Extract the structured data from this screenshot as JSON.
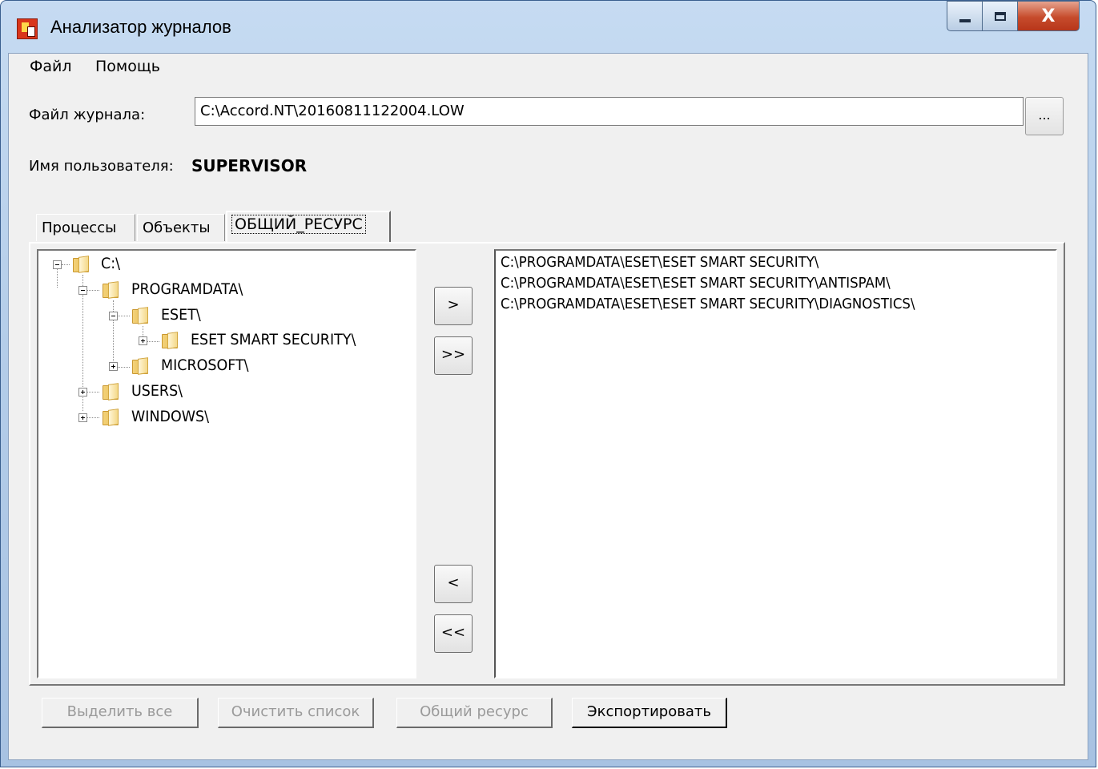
{
  "window": {
    "title": "Анализатор журналов",
    "close_glyph": "X"
  },
  "menu": {
    "items": [
      "Файл",
      "Помощь"
    ]
  },
  "logfile": {
    "label": "Файл журнала:",
    "value": "C:\\Accord.NT\\20160811122004.LOW",
    "browse_label": "..."
  },
  "user": {
    "label": "Имя пользователя:",
    "value": "SUPERVISOR"
  },
  "tabs": [
    {
      "label": "Процессы",
      "active": false
    },
    {
      "label": "Объекты",
      "active": false
    },
    {
      "label": "ОБЩИЙ_РЕСУРС",
      "active": true
    }
  ],
  "tree": {
    "nodes": [
      {
        "label": "C:\\",
        "expanded": true,
        "icon": "folder-icon"
      },
      {
        "label": "PROGRAMDATA\\",
        "expanded": true,
        "icon": "folder-icon"
      },
      {
        "label": "ESET\\",
        "expanded": true,
        "icon": "folder-icon"
      },
      {
        "label": "ESET SMART SECURITY\\",
        "expanded": false,
        "icon": "folder-icon"
      },
      {
        "label": "MICROSOFT\\",
        "expanded": false,
        "icon": "folder-icon"
      },
      {
        "label": "USERS\\",
        "expanded": false,
        "icon": "folder-icon"
      },
      {
        "label": "WINDOWS\\",
        "expanded": false,
        "icon": "folder-icon"
      }
    ]
  },
  "transfer_buttons": {
    "add_one": ">",
    "add_all": ">>",
    "remove_one": "<",
    "remove_all": "<<"
  },
  "selected_list": {
    "items": [
      "C:\\PROGRAMDATA\\ESET\\ESET SMART SECURITY\\",
      "C:\\PROGRAMDATA\\ESET\\ESET SMART SECURITY\\ANTISPAM\\",
      "C:\\PROGRAMDATA\\ESET\\ESET SMART SECURITY\\DIAGNOSTICS\\"
    ]
  },
  "bottom_buttons": {
    "select_all": "Выделить все",
    "clear_list": "Очистить список",
    "shared_resource": "Общий ресурс",
    "export": "Экспортировать"
  },
  "colors": {
    "frame": "#b4cde9",
    "dialog_bg": "#f0f0f0",
    "close_button": "#c64b2c",
    "disabled_text": "#9a9a9a"
  }
}
